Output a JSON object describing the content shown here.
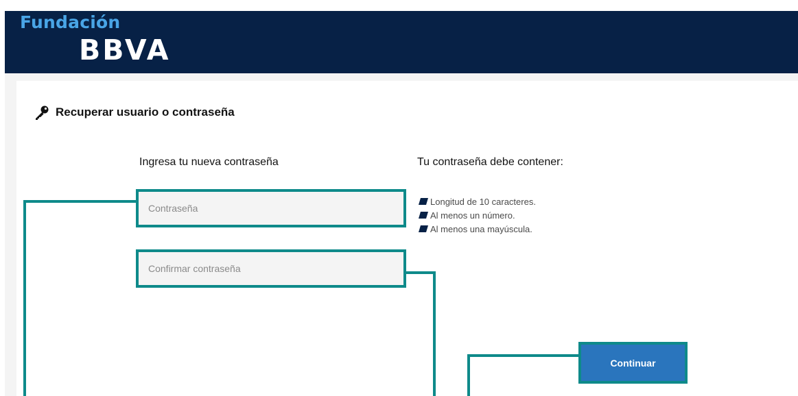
{
  "header": {
    "brand_top": "Fundación",
    "brand_main": "BBVA"
  },
  "page": {
    "title": "Recuperar usuario o contraseña",
    "title_icon": "key-icon"
  },
  "form": {
    "label": "Ingresa tu nueva contraseña",
    "password_placeholder": "Contraseña",
    "confirm_placeholder": "Confirmar contraseña",
    "submit_label": "Continuar"
  },
  "requirements": {
    "title": "Tu contraseña debe contener:",
    "items": [
      "Longitud de 10 caracteres.",
      "Al menos un número.",
      "Al menos una mayúscula."
    ]
  },
  "colors": {
    "header_bg": "#072146",
    "brand_accent": "#49a5e6",
    "highlight": "#0e8a8a",
    "button_bg": "#2a75bd"
  }
}
